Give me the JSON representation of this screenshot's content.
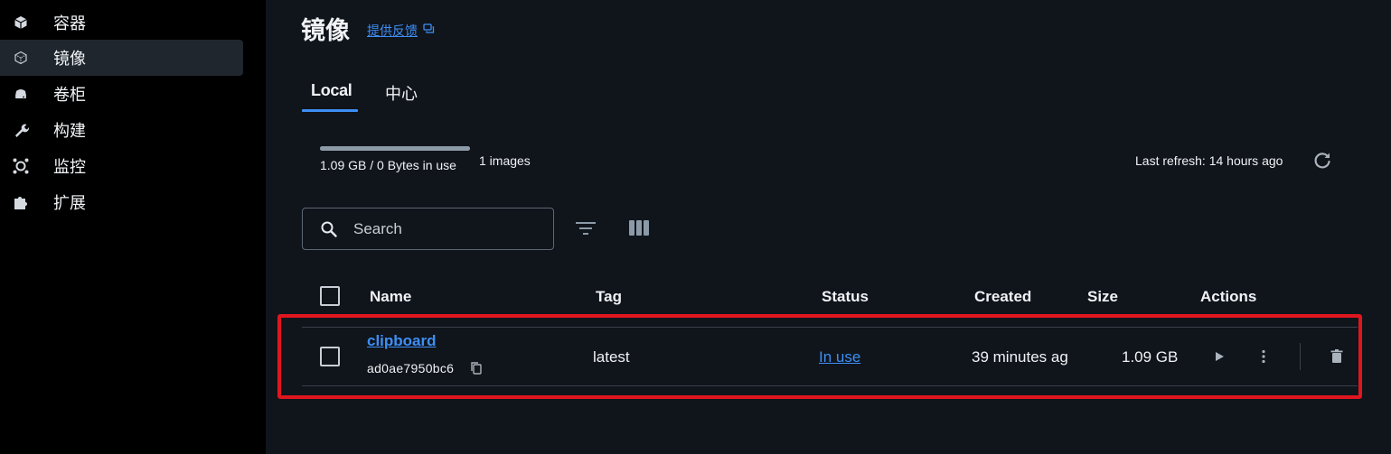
{
  "sidebar": {
    "items": [
      {
        "label": "容器",
        "icon": "container-icon",
        "active": false
      },
      {
        "label": "镜像",
        "icon": "image-icon",
        "active": true
      },
      {
        "label": "卷柜",
        "icon": "volume-icon",
        "active": false
      },
      {
        "label": "构建",
        "icon": "wrench-icon",
        "active": false
      },
      {
        "label": "监控",
        "icon": "monitor-icon",
        "active": false
      },
      {
        "label": "扩展",
        "icon": "puzzle-icon",
        "active": false
      }
    ]
  },
  "header": {
    "title": "镜像",
    "feedback_label": "提供反馈"
  },
  "tabs": [
    {
      "label": "Local",
      "active": true
    },
    {
      "label": "中心",
      "active": false
    }
  ],
  "usage": {
    "text": "1.09 GB / 0 Bytes in use",
    "fill_fraction": 1.0,
    "image_count": "1 images"
  },
  "refresh": {
    "text": "Last refresh: 14 hours ago"
  },
  "search": {
    "placeholder": "Search",
    "value": ""
  },
  "table": {
    "headers": {
      "name": "Name",
      "tag": "Tag",
      "status": "Status",
      "created": "Created",
      "size": "Size",
      "actions": "Actions"
    },
    "rows": [
      {
        "name": "clipboard",
        "id": "ad0ae7950bc6",
        "tag": "latest",
        "status": "In use",
        "created": "39 minutes ag",
        "size": "1.09 GB"
      }
    ]
  },
  "colors": {
    "accent": "#3d8ff5",
    "highlight": "#e0161f",
    "sidebar_bg": "#000000",
    "main_bg": "#10141b"
  }
}
